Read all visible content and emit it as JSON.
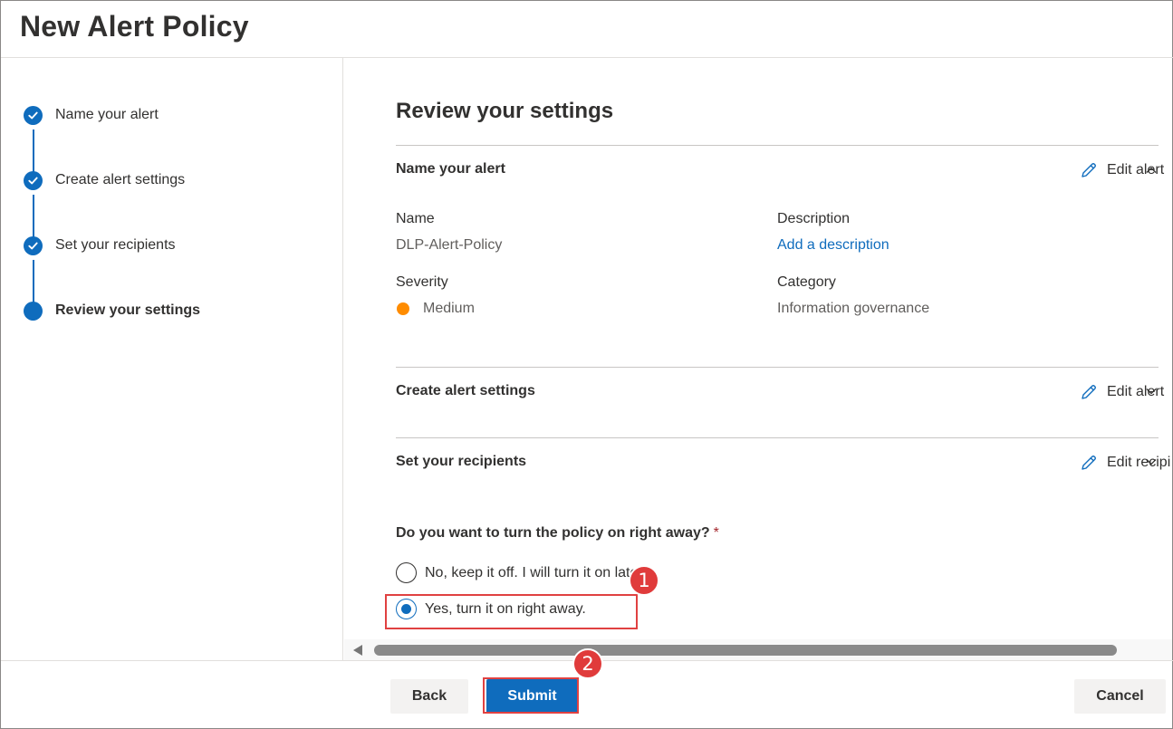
{
  "header": {
    "title": "New Alert Policy"
  },
  "nav": {
    "steps": [
      {
        "label": "Name your alert",
        "state": "completed"
      },
      {
        "label": "Create alert settings",
        "state": "completed"
      },
      {
        "label": "Set your recipients",
        "state": "completed"
      },
      {
        "label": "Review your settings",
        "state": "current"
      }
    ]
  },
  "review": {
    "heading": "Review your settings",
    "sections": [
      {
        "title": "Name your alert",
        "edit_label": "Edit alert",
        "fields": {
          "name_label": "Name",
          "name_value": "DLP-Alert-Policy",
          "description_label": "Description",
          "description_value": "Add a description",
          "severity_label": "Severity",
          "severity_value": "Medium",
          "category_label": "Category",
          "category_value": "Information governance"
        }
      },
      {
        "title": "Create alert settings",
        "edit_label": "Edit alert"
      },
      {
        "title": "Set your recipients",
        "edit_label": "Edit recipi"
      }
    ],
    "question": "Do you want to turn the policy on right away?",
    "required_mark": "*",
    "options": [
      {
        "label": "No, keep it off. I will turn it on later.",
        "checked": false
      },
      {
        "label": "Yes, turn it on right away.",
        "checked": true
      }
    ]
  },
  "annotations": {
    "badge1": "1",
    "badge2": "2"
  },
  "footer": {
    "back_label": "Back",
    "submit_label": "Submit",
    "cancel_label": "Cancel"
  },
  "colors": {
    "accent": "#0f6cbd",
    "severity_medium": "#ff8c00",
    "annotation_red": "#e03b3b"
  },
  "icons": [
    "checkmark-icon",
    "pencil-icon",
    "chevron-up-icon",
    "scroll-left-arrow-icon"
  ]
}
